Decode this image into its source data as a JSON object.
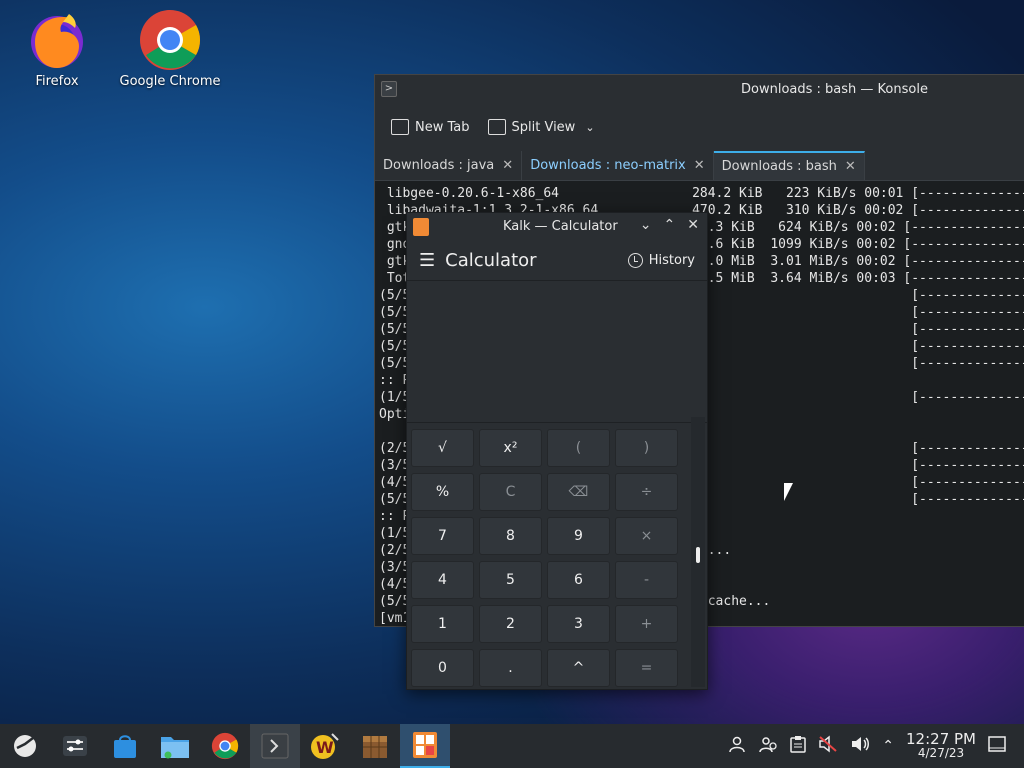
{
  "desktop": {
    "icons": [
      {
        "label": "Firefox"
      },
      {
        "label": "Google Chrome"
      }
    ]
  },
  "konsole": {
    "title": "Downloads : bash — Konsole",
    "toolbar": {
      "new_tab": "New Tab",
      "split_view": "Split View"
    },
    "tabs": [
      {
        "label": "Downloads : java"
      },
      {
        "label": "Downloads : neo-matrix"
      },
      {
        "label": "Downloads : bash"
      }
    ],
    "terminal_lines": [
      " libgee-0.20.6-1-x86_64                 284.2 KiB   223 KiB/s 00:01 [-----------------",
      " libadwaita-1:1.3.2-1-x86_64            470.2 KiB   310 KiB/s 00:02 [-----------------",
      " gtk                                     5.3 KiB   624 KiB/s 00:02 [-----------------",
      " gno                                     8.6 KiB  1099 KiB/s 00:02 [-----------------",
      " gtk                                     6.0 MiB  3.01 MiB/s 00:02 [-----------------",
      " Tot                                     9.5 MiB  3.64 MiB/s 00:03 [-----------------",
      "(5/5                                                                [-----------------",
      "(5/5                                                                [-----------------",
      "(5/5                                                                [-----------------",
      "(5/5                                                                [-----------------",
      "(5/5                                                                [-----------------",
      ":: P",
      "(1/5                                                                [-----------------",
      "Opti",
      "",
      "(2/5                                                                [-----------------",
      "(3/5                                                                [-----------------",
      "(4/5                                                                [-----------------",
      "(5/5                                                                [-----------------",
      ":: P",
      "(1/5",
      "(2/5                                     s...",
      "(3/5",
      "(4/5",
      "(5/5                                      cache...",
      "[vm1"
    ]
  },
  "calculator": {
    "title": "Kalk — Calculator",
    "heading": "Calculator",
    "history_label": "History",
    "keys": [
      {
        "label": "√",
        "kind": "op"
      },
      {
        "label": "x²",
        "kind": "op"
      },
      {
        "label": "(",
        "kind": "dim"
      },
      {
        "label": ")",
        "kind": "dim"
      },
      {
        "label": "%",
        "kind": "op"
      },
      {
        "label": "C",
        "kind": "dim"
      },
      {
        "label": "⌫",
        "kind": "dim"
      },
      {
        "label": "÷",
        "kind": "dim"
      },
      {
        "label": "7",
        "kind": "num"
      },
      {
        "label": "8",
        "kind": "num"
      },
      {
        "label": "9",
        "kind": "num"
      },
      {
        "label": "×",
        "kind": "dim"
      },
      {
        "label": "4",
        "kind": "num"
      },
      {
        "label": "5",
        "kind": "num"
      },
      {
        "label": "6",
        "kind": "num"
      },
      {
        "label": "-",
        "kind": "dim"
      },
      {
        "label": "1",
        "kind": "num"
      },
      {
        "label": "2",
        "kind": "num"
      },
      {
        "label": "3",
        "kind": "num"
      },
      {
        "label": "+",
        "kind": "dim"
      },
      {
        "label": "0",
        "kind": "num"
      },
      {
        "label": ".",
        "kind": "num"
      },
      {
        "label": "^",
        "kind": "num"
      },
      {
        "label": "=",
        "kind": "dim"
      }
    ]
  },
  "taskbar": {
    "clock_time": "12:27 PM",
    "clock_date": "4/27/23"
  },
  "colors": {
    "accent": "#3daee9",
    "calculator_icon": "#f08a35"
  }
}
